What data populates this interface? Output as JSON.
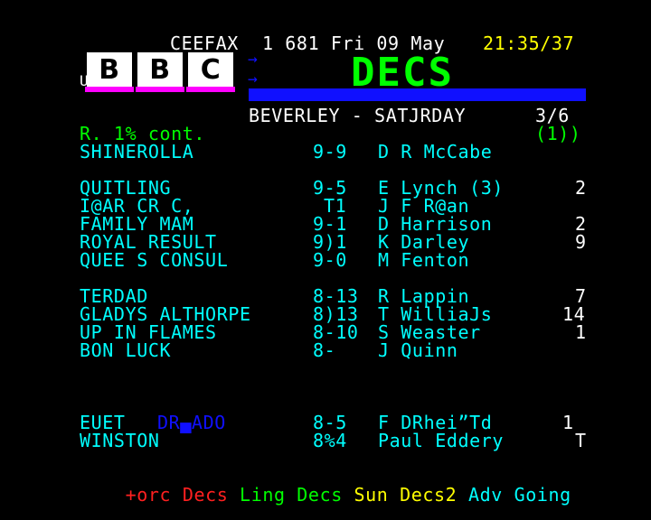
{
  "header": {
    "service": "CEEFAX",
    "page_info": "1 681 Fri 09 May",
    "time": "21:35/37"
  },
  "logo": {
    "prefix": "U",
    "letters": [
      "B",
      "B",
      "C"
    ]
  },
  "page_title": "DECS",
  "meeting": {
    "name": "BEVERLEY - SATJRDAY",
    "page_count": "3/6"
  },
  "race_header": {
    "left": "R. 1% cont.",
    "right": "(1))"
  },
  "runners": [
    {
      "horse": "SHINEROLLA",
      "weight": "9-9",
      "jockey": "D R McCabe",
      "draw": ""
    },
    {
      "horse": "QUITLING",
      "weight": "9-5",
      "jockey": "E Lynch (3)",
      "draw": "2"
    },
    {
      "horse": "I@AR CR C,",
      "weight": "T1",
      "jockey": "J F R@an",
      "draw": ""
    },
    {
      "horse": "FAMILY MAM",
      "weight": "9-1",
      "jockey": "D Harrison",
      "draw": "2"
    },
    {
      "horse": "ROYAL RESULT",
      "weight": "9)1",
      "jockey": "K Darley",
      "draw": "9"
    },
    {
      "horse": "QUEE S CONSUL",
      "weight": "9-0",
      "jockey": "M Fenton",
      "draw": ""
    },
    {
      "horse": "TERDAD",
      "weight": "8-13",
      "jockey": "R Lappin",
      "draw": "7"
    },
    {
      "horse": "GLADYS ALTHORPE",
      "weight": "8)13",
      "jockey": "T WilliaJs",
      "draw": "14"
    },
    {
      "horse": "UP IN FLAMES",
      "weight": "8-10",
      "jockey": "S Weaster",
      "draw": "1"
    },
    {
      "horse": "BON LUCK",
      "weight": "8-",
      "jockey": "J Quinn",
      "draw": ""
    },
    {
      "horse": "EUET",
      "horse_extra": "DR▄ADO",
      "weight": "8-5",
      "jockey": "F DRhei”Td",
      "draw": "1"
    },
    {
      "horse": "WINSTON",
      "weight": "8%4",
      "jockey": "Paul Eddery",
      "draw": "T"
    }
  ],
  "fastext": [
    {
      "label": "+orc",
      "color": "#ff2020"
    },
    {
      "label": "Decs",
      "color": "#ff2020"
    },
    {
      "label": "Ling",
      "color": "#00ff00"
    },
    {
      "label": "Decs",
      "color": "#00ff00"
    },
    {
      "label": "Sun",
      "color": "#ffff00"
    },
    {
      "label": "Decs2",
      "color": "#ffff00"
    },
    {
      "label": "Adv",
      "color": "#00ffff"
    },
    {
      "label": "Going",
      "color": "#00ffff"
    }
  ]
}
